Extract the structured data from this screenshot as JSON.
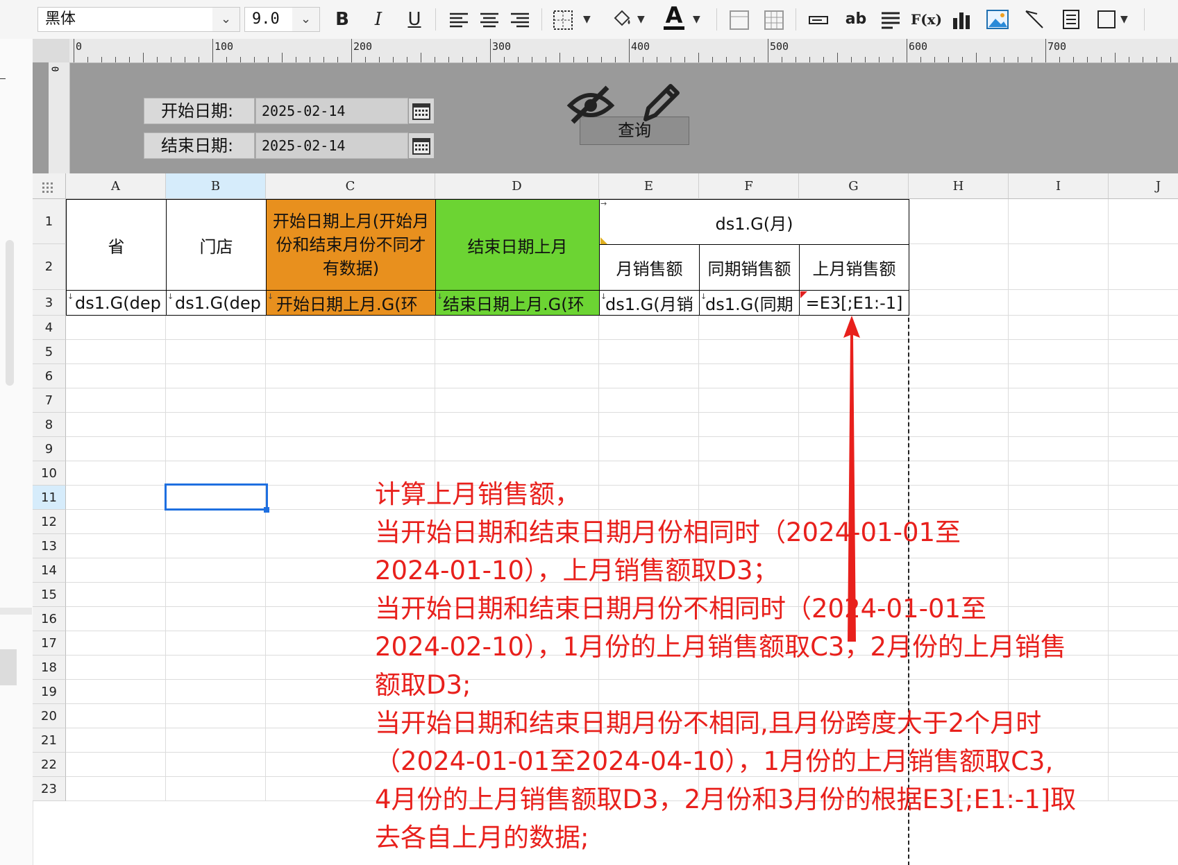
{
  "toolbar": {
    "font_name": "黑体",
    "font_size": "9.0",
    "bold": "B",
    "italic": "I",
    "underline": "U",
    "text_tool": "ab",
    "formula_tool": "F(x)"
  },
  "ruler": {
    "labels": [
      "0",
      "100",
      "200",
      "300",
      "400",
      "500",
      "600",
      "700"
    ],
    "vertical_label": "0"
  },
  "params": {
    "start_label": "开始日期:",
    "start_value": "2025-02-14",
    "end_label": "结束日期:",
    "end_value": "2025-02-14",
    "query_button": "查询"
  },
  "sheet": {
    "columns": [
      "A",
      "B",
      "C",
      "D",
      "E",
      "F",
      "G",
      "H",
      "I",
      "J"
    ],
    "rows": [
      "1",
      "2",
      "3",
      "4",
      "5",
      "6",
      "7",
      "8",
      "9",
      "10",
      "11",
      "12",
      "13",
      "14",
      "15",
      "16",
      "17",
      "18",
      "19",
      "20",
      "21",
      "22",
      "23"
    ],
    "header": {
      "province": "省",
      "store": "门店",
      "start_prev_month": "开始日期上月(开始月份和结束月份不同才有数据)",
      "end_prev_month": "结束日期上月",
      "month_group": "ds1.G(月)",
      "month_sales": "月销售额",
      "yoy_sales": "同期销售额",
      "prev_month_sales": "上月销售额"
    },
    "row3": [
      "ds1.G(dep",
      "ds1.G(dep",
      "开始日期上月.G(环",
      "结束日期上月.G(环",
      "ds1.G(月销",
      "ds1.G(同期",
      "=E3[;E1:-1]"
    ]
  },
  "colors": {
    "orange": "#e8901e",
    "green": "#6cd433",
    "annotation": "#e8201c",
    "selection": "#1e6fe0"
  },
  "annotation": {
    "lines": [
      "计算上月销售额，",
      "当开始日期和结束日期月份相同时（2024-01-01至",
      "2024-01-10），上月销售额取D3；",
      "当开始日期和结束日期月份不相同时（2024-01-01至",
      "2024-02-10），1月份的上月销售额取C3，2月份的上月销售",
      "额取D3;",
      "当开始日期和结束日期月份不相同,且月份跨度大于2个月时",
      "（2024-01-01至2024-04-10），1月份的上月销售额取C3,",
      "4月份的上月销售额取D3，2月份和3月份的根据E3[;E1:-1]取",
      "去各自上月的数据;"
    ]
  },
  "icons": [
    "align-left-icon",
    "align-center-icon",
    "align-right-icon",
    "border-icon",
    "fill-color-icon",
    "font-color-icon",
    "eye-off-icon",
    "pencil-icon",
    "calendar-icon",
    "bar-chart-icon",
    "image-icon"
  ]
}
